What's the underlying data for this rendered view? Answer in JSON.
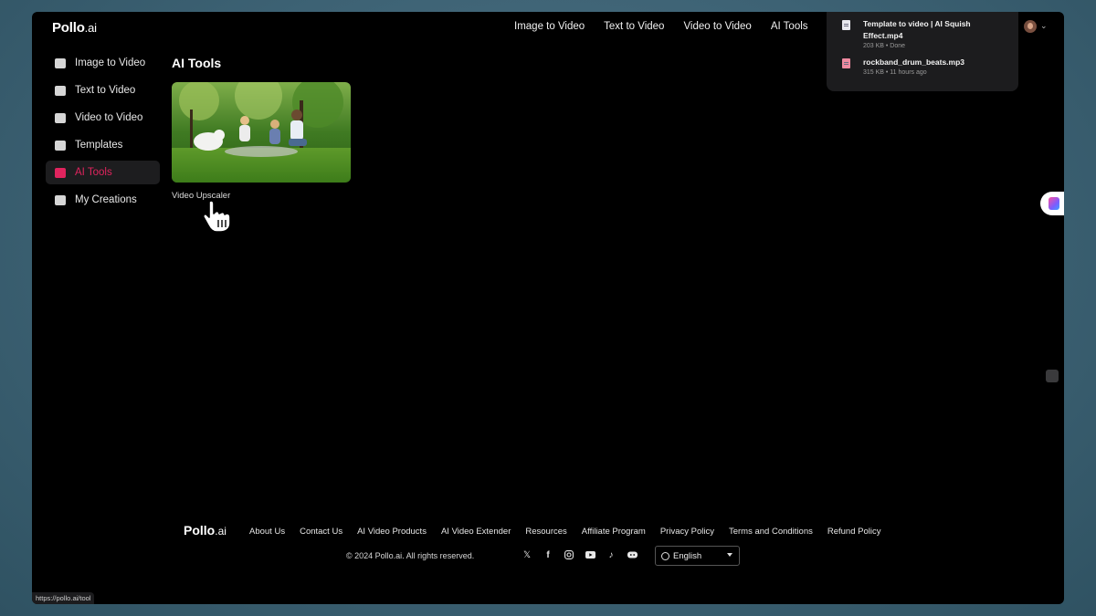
{
  "brand": {
    "name": "Pollo",
    "suffix": ".ai"
  },
  "topnav": [
    "Image to Video",
    "Text to Video",
    "Video to Video",
    "AI Tools"
  ],
  "downloads": [
    {
      "name": "Template to video | AI Squish Effect.mp4",
      "meta": "203 KB • Done",
      "icon": "video-file-icon"
    },
    {
      "name": "rockband_drum_beats.mp3",
      "meta": "315 KB • 11 hours ago",
      "icon": "audio-file-icon"
    }
  ],
  "sidebar": {
    "items": [
      {
        "label": "Image to Video",
        "icon": "image-icon",
        "active": false
      },
      {
        "label": "Text to Video",
        "icon": "text-icon",
        "active": false
      },
      {
        "label": "Video to Video",
        "icon": "video-icon",
        "active": false
      },
      {
        "label": "Templates",
        "icon": "templates-icon",
        "active": false
      },
      {
        "label": "AI Tools",
        "icon": "ai-tools-icon",
        "active": true
      },
      {
        "label": "My Creations",
        "icon": "folder-icon",
        "active": false
      }
    ]
  },
  "main": {
    "title": "AI Tools",
    "tools": [
      {
        "name": "Video Upscaler"
      }
    ]
  },
  "footer": {
    "links": [
      "About Us",
      "Contact Us",
      "AI Video Products",
      "AI Video Extender",
      "Resources",
      "Affiliate Program",
      "Privacy Policy",
      "Terms and Conditions",
      "Refund Policy"
    ],
    "copyright": "© 2024 Pollo.ai. All rights reserved.",
    "socials": [
      "x-icon",
      "facebook-icon",
      "instagram-icon",
      "youtube-icon",
      "tiktok-icon",
      "discord-icon"
    ],
    "language": "English"
  },
  "status_url": "https://pollo.ai/tool",
  "colors": {
    "accent": "#e0245e",
    "background": "#000000"
  }
}
